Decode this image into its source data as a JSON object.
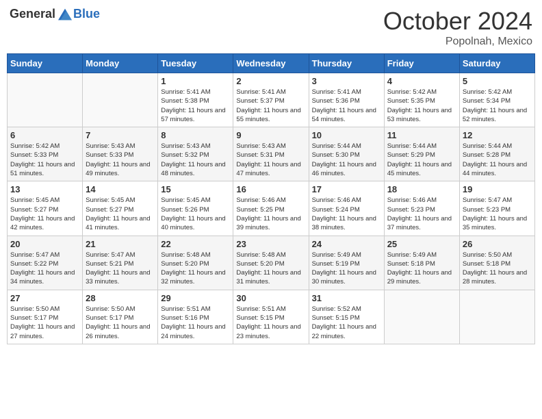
{
  "header": {
    "logo_general": "General",
    "logo_blue": "Blue",
    "month": "October 2024",
    "location": "Popolnah, Mexico"
  },
  "days_of_week": [
    "Sunday",
    "Monday",
    "Tuesday",
    "Wednesday",
    "Thursday",
    "Friday",
    "Saturday"
  ],
  "weeks": [
    [
      {
        "day": "",
        "info": ""
      },
      {
        "day": "",
        "info": ""
      },
      {
        "day": "1",
        "info": "Sunrise: 5:41 AM\nSunset: 5:38 PM\nDaylight: 11 hours and 57 minutes."
      },
      {
        "day": "2",
        "info": "Sunrise: 5:41 AM\nSunset: 5:37 PM\nDaylight: 11 hours and 55 minutes."
      },
      {
        "day": "3",
        "info": "Sunrise: 5:41 AM\nSunset: 5:36 PM\nDaylight: 11 hours and 54 minutes."
      },
      {
        "day": "4",
        "info": "Sunrise: 5:42 AM\nSunset: 5:35 PM\nDaylight: 11 hours and 53 minutes."
      },
      {
        "day": "5",
        "info": "Sunrise: 5:42 AM\nSunset: 5:34 PM\nDaylight: 11 hours and 52 minutes."
      }
    ],
    [
      {
        "day": "6",
        "info": "Sunrise: 5:42 AM\nSunset: 5:33 PM\nDaylight: 11 hours and 51 minutes."
      },
      {
        "day": "7",
        "info": "Sunrise: 5:43 AM\nSunset: 5:33 PM\nDaylight: 11 hours and 49 minutes."
      },
      {
        "day": "8",
        "info": "Sunrise: 5:43 AM\nSunset: 5:32 PM\nDaylight: 11 hours and 48 minutes."
      },
      {
        "day": "9",
        "info": "Sunrise: 5:43 AM\nSunset: 5:31 PM\nDaylight: 11 hours and 47 minutes."
      },
      {
        "day": "10",
        "info": "Sunrise: 5:44 AM\nSunset: 5:30 PM\nDaylight: 11 hours and 46 minutes."
      },
      {
        "day": "11",
        "info": "Sunrise: 5:44 AM\nSunset: 5:29 PM\nDaylight: 11 hours and 45 minutes."
      },
      {
        "day": "12",
        "info": "Sunrise: 5:44 AM\nSunset: 5:28 PM\nDaylight: 11 hours and 44 minutes."
      }
    ],
    [
      {
        "day": "13",
        "info": "Sunrise: 5:45 AM\nSunset: 5:27 PM\nDaylight: 11 hours and 42 minutes."
      },
      {
        "day": "14",
        "info": "Sunrise: 5:45 AM\nSunset: 5:27 PM\nDaylight: 11 hours and 41 minutes."
      },
      {
        "day": "15",
        "info": "Sunrise: 5:45 AM\nSunset: 5:26 PM\nDaylight: 11 hours and 40 minutes."
      },
      {
        "day": "16",
        "info": "Sunrise: 5:46 AM\nSunset: 5:25 PM\nDaylight: 11 hours and 39 minutes."
      },
      {
        "day": "17",
        "info": "Sunrise: 5:46 AM\nSunset: 5:24 PM\nDaylight: 11 hours and 38 minutes."
      },
      {
        "day": "18",
        "info": "Sunrise: 5:46 AM\nSunset: 5:23 PM\nDaylight: 11 hours and 37 minutes."
      },
      {
        "day": "19",
        "info": "Sunrise: 5:47 AM\nSunset: 5:23 PM\nDaylight: 11 hours and 35 minutes."
      }
    ],
    [
      {
        "day": "20",
        "info": "Sunrise: 5:47 AM\nSunset: 5:22 PM\nDaylight: 11 hours and 34 minutes."
      },
      {
        "day": "21",
        "info": "Sunrise: 5:47 AM\nSunset: 5:21 PM\nDaylight: 11 hours and 33 minutes."
      },
      {
        "day": "22",
        "info": "Sunrise: 5:48 AM\nSunset: 5:20 PM\nDaylight: 11 hours and 32 minutes."
      },
      {
        "day": "23",
        "info": "Sunrise: 5:48 AM\nSunset: 5:20 PM\nDaylight: 11 hours and 31 minutes."
      },
      {
        "day": "24",
        "info": "Sunrise: 5:49 AM\nSunset: 5:19 PM\nDaylight: 11 hours and 30 minutes."
      },
      {
        "day": "25",
        "info": "Sunrise: 5:49 AM\nSunset: 5:18 PM\nDaylight: 11 hours and 29 minutes."
      },
      {
        "day": "26",
        "info": "Sunrise: 5:50 AM\nSunset: 5:18 PM\nDaylight: 11 hours and 28 minutes."
      }
    ],
    [
      {
        "day": "27",
        "info": "Sunrise: 5:50 AM\nSunset: 5:17 PM\nDaylight: 11 hours and 27 minutes."
      },
      {
        "day": "28",
        "info": "Sunrise: 5:50 AM\nSunset: 5:17 PM\nDaylight: 11 hours and 26 minutes."
      },
      {
        "day": "29",
        "info": "Sunrise: 5:51 AM\nSunset: 5:16 PM\nDaylight: 11 hours and 24 minutes."
      },
      {
        "day": "30",
        "info": "Sunrise: 5:51 AM\nSunset: 5:15 PM\nDaylight: 11 hours and 23 minutes."
      },
      {
        "day": "31",
        "info": "Sunrise: 5:52 AM\nSunset: 5:15 PM\nDaylight: 11 hours and 22 minutes."
      },
      {
        "day": "",
        "info": ""
      },
      {
        "day": "",
        "info": ""
      }
    ]
  ]
}
